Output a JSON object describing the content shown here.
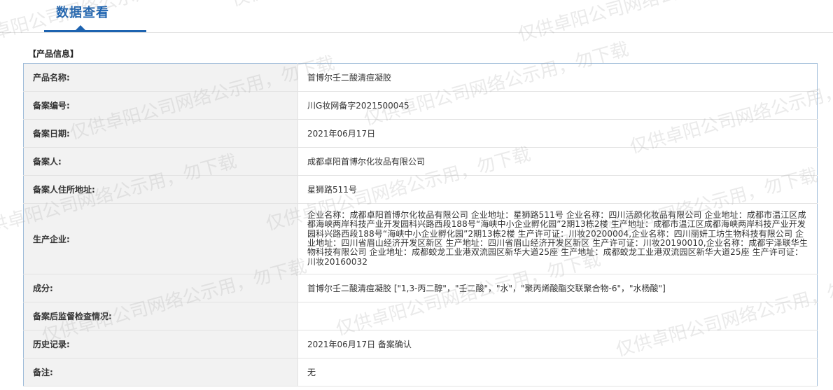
{
  "header": {
    "tab_title": "数据查看"
  },
  "section": {
    "title": "【产品信息】"
  },
  "rows": [
    {
      "label": "产品名称:",
      "value": "首博尔壬二酸清痘凝胶"
    },
    {
      "label": "备案编号:",
      "value": "川G妆网备字2021500045"
    },
    {
      "label": "备案日期:",
      "value": "2021年06月17日"
    },
    {
      "label": "备案人:",
      "value": "成都卓阳首博尔化妆品有限公司"
    },
    {
      "label": "备案人住所地址:",
      "value": "星狮路511号"
    },
    {
      "label": "生产企业:",
      "value": "企业名称：成都卓阳首博尔化妆品有限公司 企业地址：星狮路511号 企业名称：四川活颜化妆品有限公司 企业地址：成都市温江区成都海峡两岸科技产业开发园科兴路西段188号“海峡中小企业孵化园”2期13栋2楼 生产地址：成都市温江区成都海峡两岸科技产业开发园科兴路西段188号“海峡中小企业孵化园”2期13栋2楼 生产许可证：川妆20200004,企业名称：四川丽妍工坊生物科技有限公司 企业地址：四川省眉山经济开发区新区 生产地址：四川省眉山经济开发区新区 生产许可证：川妆20190010,企业名称：成都宇泽联华生物科技有限公司 企业地址：成都蛟龙工业港双流园区新华大道25座 生产地址：成都蛟龙工业港双流园区新华大道25座 生产许可证：川妆20160032"
    },
    {
      "label": "成分:",
      "value": "首博尔壬二酸清痘凝胶 [\"1,3-丙二醇\"，\"壬二酸\"，\"水\"，\"聚丙烯酸酯交联聚合物-6\"，\"水杨酸\"]"
    },
    {
      "label": "备案后监督检查情况:",
      "value": ""
    },
    {
      "label": "历史记录:",
      "value": "2021年06月17日 备案确认"
    },
    {
      "label": "备注:",
      "value": "无"
    }
  ],
  "watermark": {
    "text": "仅供卓阳公司网络公示用，勿下载"
  }
}
